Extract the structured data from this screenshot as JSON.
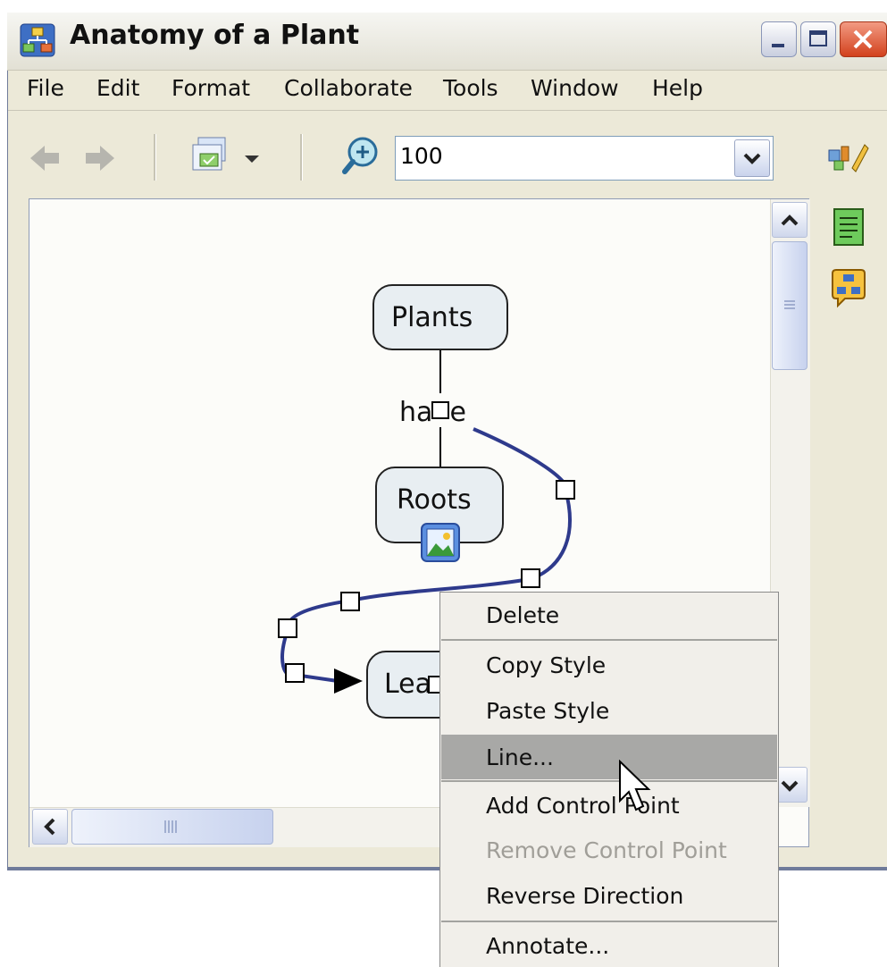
{
  "window": {
    "title": "Anatomy of a Plant",
    "controls": [
      "minimize",
      "maximize",
      "close"
    ]
  },
  "menubar": {
    "items": [
      "File",
      "Edit",
      "Format",
      "Collaborate",
      "Tools",
      "Window",
      "Help"
    ]
  },
  "toolbar": {
    "zoom_value": "100",
    "icons": [
      "back-arrow-icon",
      "forward-arrow-icon",
      "view-icon",
      "zoom-icon",
      "edit-icon"
    ]
  },
  "concept_map": {
    "nodes": [
      {
        "id": "plants",
        "label": "Plants"
      },
      {
        "id": "roots",
        "label": "Roots",
        "has_image": true
      },
      {
        "id": "leaves",
        "label": "Lea"
      }
    ],
    "linking_phrase": "ha  e",
    "selected_line_color": "#2e3a8c"
  },
  "context_menu": {
    "items": [
      {
        "label": "Delete",
        "enabled": true
      },
      {
        "label": "Copy Style",
        "enabled": true
      },
      {
        "label": "Paste Style",
        "enabled": true
      },
      {
        "label": "Line...",
        "enabled": true,
        "highlighted": true
      },
      {
        "label": "Add Control Point",
        "enabled": true
      },
      {
        "label": "Remove Control Point",
        "enabled": false
      },
      {
        "label": "Reverse Direction",
        "enabled": true
      },
      {
        "label": "Annotate...",
        "enabled": true
      }
    ]
  },
  "side_panel": {
    "icons": [
      "edit-style-icon",
      "document-icon",
      "collaborate-icon"
    ]
  }
}
